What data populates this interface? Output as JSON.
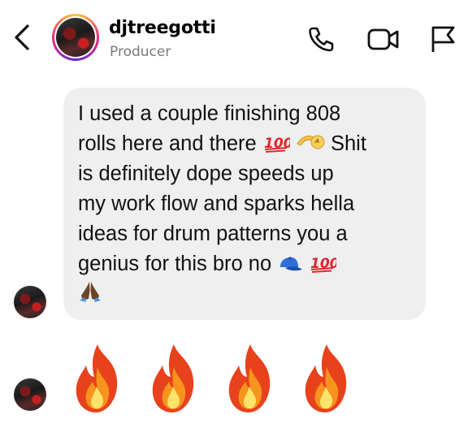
{
  "header": {
    "username": "djtreegotti",
    "subtitle": "Producer",
    "icons": [
      "back-chevron-icon",
      "phone-icon",
      "video-camera-icon",
      "flag-icon"
    ]
  },
  "messages": [
    {
      "text_parts": [
        "I used a couple finishing 808\nrolls here and there ",
        " ",
        " Shit\nis definitely dope speeds up\nmy work flow and sparks hella\nideas for drum patterns you a\ngenius for this bro no ",
        " ",
        "\n"
      ],
      "emojis": [
        "hundred-points",
        "pinching-hand",
        "cap",
        "hundred-points",
        "folded-hands"
      ]
    },
    {
      "emoji_reaction": [
        "fire",
        "fire",
        "fire",
        "fire"
      ]
    }
  ],
  "colors": {
    "bubble": "#efefef",
    "subtitle": "#7a7a7a",
    "emoji_red": "#e3242b"
  }
}
